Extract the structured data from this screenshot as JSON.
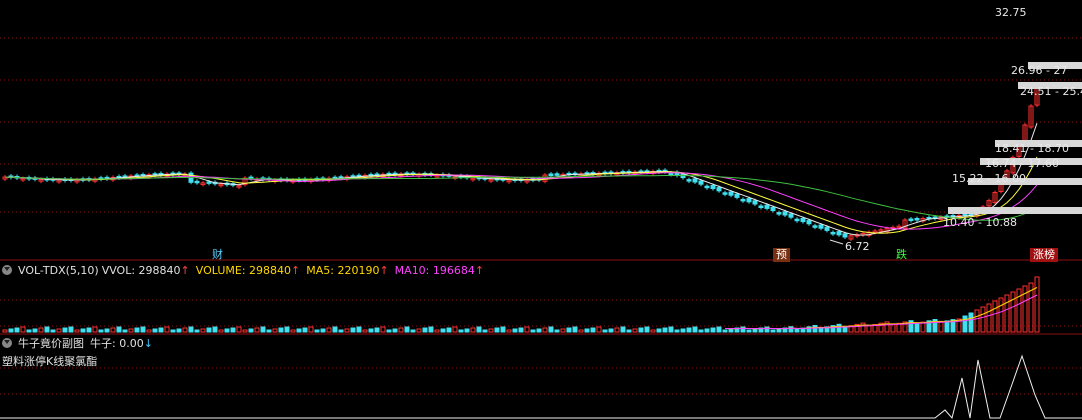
{
  "price_panel": {
    "labels": {
      "high": "32.75",
      "lvl1": "26.96 - 27",
      "lvl2": "24.51 - 25.4",
      "lvl3": "18.41 - 18.70",
      "lvl4": "16.74 - 17.60",
      "lvl5": "15.22 - 16.00",
      "lvl6": "10.40 - 10.88",
      "low": "6.72"
    },
    "markers": {
      "cai": "财",
      "yu": "预",
      "die": "跌",
      "zhangbang": "涨榜"
    }
  },
  "volume_panel": {
    "name": "VOL-TDX(5,10)",
    "vvol_label": "VVOL: 298840",
    "volume_label": "VOLUME: 298840",
    "ma5_label": "MA5: 220190",
    "ma10_label": "MA10: 196684",
    "arrow": "↑",
    "colors": {
      "vvol": "#e0e0e0",
      "volume": "#ffd700",
      "ma5": "#ffd700",
      "ma10": "#ff40ff"
    }
  },
  "niuzi_panel": {
    "name": "牛子竟价副图",
    "value_label": "牛子: 0.00",
    "arrow": "↓",
    "subtitle": "塑料涨停K线聚氯酯"
  },
  "colors": {
    "up": "#ff3030",
    "down": "#40e0f0",
    "ma_white": "#e8e8e8",
    "ma_yellow": "#ffff40",
    "ma_magenta": "#ff40ff",
    "ma_green": "#40c040",
    "grid": "#8b1010"
  }
}
